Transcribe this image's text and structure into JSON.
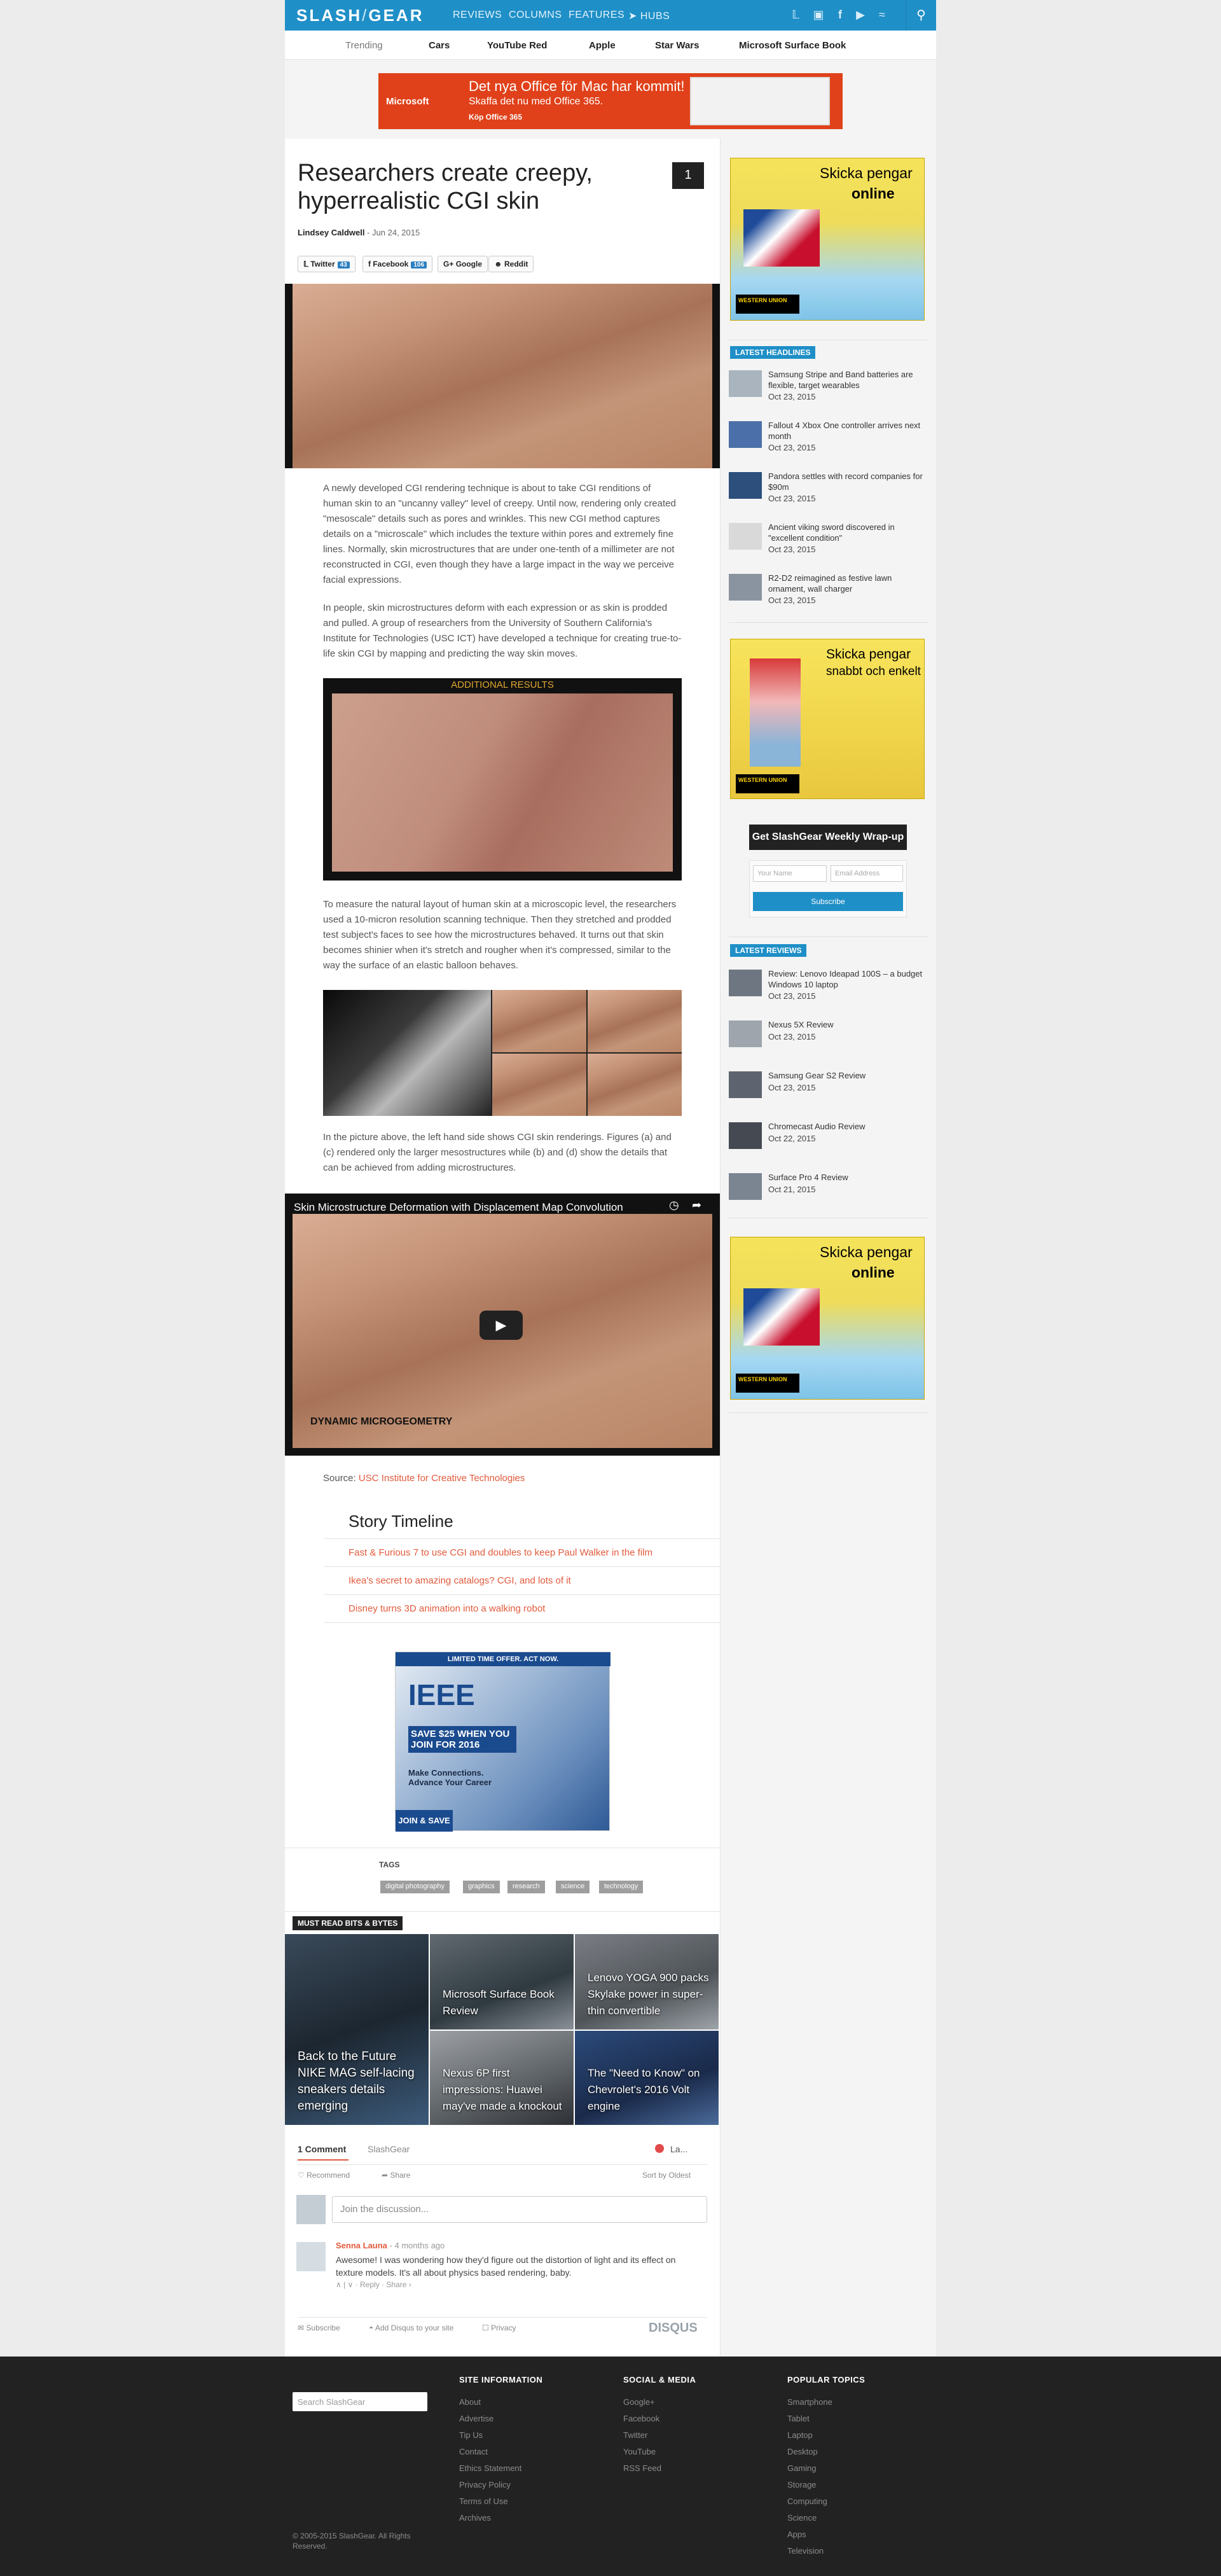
{
  "brand": {
    "logo_a": "SLASH",
    "logo_sep": "/",
    "logo_b": "GEAR"
  },
  "nav": {
    "items": [
      "REVIEWS",
      "COLUMNS",
      "FEATURES",
      "HUBS"
    ],
    "colors": {
      "bar": "#1f8fc7"
    }
  },
  "social_icons": [
    "twitter-icon",
    "instagram-icon",
    "facebook-icon",
    "youtube-icon",
    "rss-icon"
  ],
  "trending": {
    "label": "Trending",
    "items": [
      "Cars",
      "YouTube Red",
      "Apple",
      "Star Wars",
      "Microsoft Surface Book"
    ]
  },
  "top_ad": {
    "line1": "Det nya Office för Mac har kommit!",
    "line2": "Skaffa det nu med Office 365.",
    "cta": "Köp Office 365",
    "brand": "Microsoft"
  },
  "article": {
    "title": "Researchers create creepy, hyperrealistic CGI skin",
    "comment_count": "1",
    "author": "Lindsey Caldwell",
    "date": "- Jun 24, 2015",
    "share": [
      {
        "label": "Twitter",
        "count": "43"
      },
      {
        "label": "Facebook",
        "count": "106"
      },
      {
        "label": "Google",
        "count": ""
      },
      {
        "label": "Reddit",
        "count": ""
      }
    ],
    "paragraphs": [
      "A newly developed CGI rendering technique is about to take CGI renditions of human skin to an \"uncanny valley\" level of creepy. Until now, rendering only created \"mesoscale\" details such as pores and wrinkles. This new CGI method captures details on a \"microscale\" which includes the texture within pores and extremely fine lines. Normally, skin microstructures that are under one-tenth of a millimeter are not reconstructed in CGI, even though they have a large impact in the way we perceive facial expressions.",
      "In people, skin microstructures deform with each expression or as skin is prodded and pulled. A group of researchers from the University of Southern California's Institute for Technologies (USC ICT) have developed a technique for creating true-to-life skin CGI by mapping and predicting the way skin moves.",
      "To measure the natural layout of human skin at a microscopic level, the researchers used a 10-micron resolution scanning technique. Then they stretched and prodded test subject's faces to see how the microstructures behaved. It turns out that skin becomes shinier when it's stretch and rougher when it's compressed, similar to the way the surface of an elastic balloon behaves.",
      "In the picture above, the left hand side shows CGI skin renderings. Figures (a) and (c) rendered only the larger mesostructures while (b) and (d) show the details that can be achieved from adding microstructures."
    ],
    "figure_label": "ADDITIONAL RESULTS",
    "video_title": "Skin Microstructure Deformation with Displacement Map Convolution",
    "video_caption": "DYNAMIC MICROGEOMETRY",
    "source_label": "Source:",
    "source_link": "USC Institute for Creative Technologies"
  },
  "timeline": {
    "heading": "Story Timeline",
    "items": [
      "Fast & Furious 7 to use CGI and doubles to keep Paul Walker in the film",
      "Ikea's secret to amazing catalogs? CGI, and lots of it",
      "Disney turns 3D animation into a walking robot"
    ]
  },
  "ieee_ad": {
    "top": "LIMITED TIME OFFER. ACT NOW.",
    "brand": "IEEE",
    "offer": "SAVE $25 WHEN YOU JOIN FOR 2016",
    "tag": "Make Connections. Advance Your Career",
    "cta": "JOIN & SAVE"
  },
  "tags": {
    "heading": "TAGS",
    "items": [
      "digital photography",
      "graphics",
      "research",
      "science",
      "technology"
    ]
  },
  "must_read": {
    "heading": "MUST READ BITS & BYTES",
    "items": [
      "Back to the Future NIKE MAG self-lacing sneakers details emerging",
      "Microsoft Surface Book Review",
      "Lenovo YOGA 900 packs Skylake power in super-thin convertible",
      "Nexus 6P first impressions: Huawei may've made a knockout",
      "The \"Need to Know\" on Chevrolet's 2016 Volt engine"
    ]
  },
  "comments": {
    "tab_comments": "1 Comment",
    "tab_site": "SlashGear",
    "login": "La...",
    "recommend": "Recommend",
    "share": "Share",
    "sort": "Sort by Oldest",
    "placeholder": "Join the discussion...",
    "items": [
      {
        "author": "Senna Launa",
        "time": "- 4 months ago",
        "text": "Awesome! I was wondering how they'd figure out the distortion of light and its effect on texture models. It's all about physics based rendering, baby.",
        "actions": "∧ | ∨ · Reply · Share ›"
      }
    ],
    "footer": {
      "subscribe": "Subscribe",
      "add": "Add Disqus to your site",
      "privacy": "Privacy",
      "brand": "DISQUS"
    }
  },
  "sidebar": {
    "ad1": {
      "text1": "Skicka pengar",
      "text2": "online"
    },
    "latest_headlines": {
      "heading": "LATEST HEADLINES",
      "items": [
        {
          "title": "Samsung Stripe and Band batteries are flexible, target wearables",
          "date": "Oct 23, 2015"
        },
        {
          "title": "Fallout 4 Xbox One controller arrives next month",
          "date": "Oct 23, 2015"
        },
        {
          "title": "Pandora settles with record companies for $90m",
          "date": "Oct 23, 2015"
        },
        {
          "title": "Ancient viking sword discovered in \"excellent condition\"",
          "date": "Oct 23, 2015"
        },
        {
          "title": "R2-D2 reimagined as festive lawn ornament, wall charger",
          "date": "Oct 23, 2015"
        }
      ]
    },
    "ad2": {
      "text1": "Skicka pengar",
      "text2": "snabbt och enkelt"
    },
    "newsletter": {
      "heading": "Get SlashGear Weekly Wrap-up",
      "name_ph": "Your Name",
      "email_ph": "Email Address",
      "button": "Subscribe"
    },
    "latest_reviews": {
      "heading": "LATEST REVIEWS",
      "items": [
        {
          "title": "Review: Lenovo Ideapad 100S – a budget Windows 10 laptop",
          "date": "Oct 23, 2015"
        },
        {
          "title": "Nexus 5X Review",
          "date": "Oct 23, 2015"
        },
        {
          "title": "Samsung Gear S2 Review",
          "date": "Oct 23, 2015"
        },
        {
          "title": "Chromecast Audio Review",
          "date": "Oct 22, 2015"
        },
        {
          "title": "Surface Pro 4 Review",
          "date": "Oct 21, 2015"
        }
      ]
    },
    "ad3": {
      "text1": "Skicka pengar",
      "text2": "online"
    },
    "wu": "WESTERN UNION"
  },
  "footer": {
    "search_ph": "Search SlashGear",
    "site_info": {
      "heading": "SITE INFORMATION",
      "items": [
        "About",
        "Advertise",
        "Tip Us",
        "Contact",
        "Ethics Statement",
        "Privacy Policy",
        "Terms of Use",
        "Archives"
      ]
    },
    "social": {
      "heading": "SOCIAL & MEDIA",
      "items": [
        "Google+",
        "Facebook",
        "Twitter",
        "YouTube",
        "RSS Feed"
      ]
    },
    "popular": {
      "heading": "POPULAR TOPICS",
      "items": [
        "Smartphone",
        "Tablet",
        "Laptop",
        "Desktop",
        "Gaming",
        "Storage",
        "Computing",
        "Science",
        "Apps",
        "Television"
      ]
    },
    "copyright": "© 2005-2015 SlashGear. All Rights Reserved."
  }
}
